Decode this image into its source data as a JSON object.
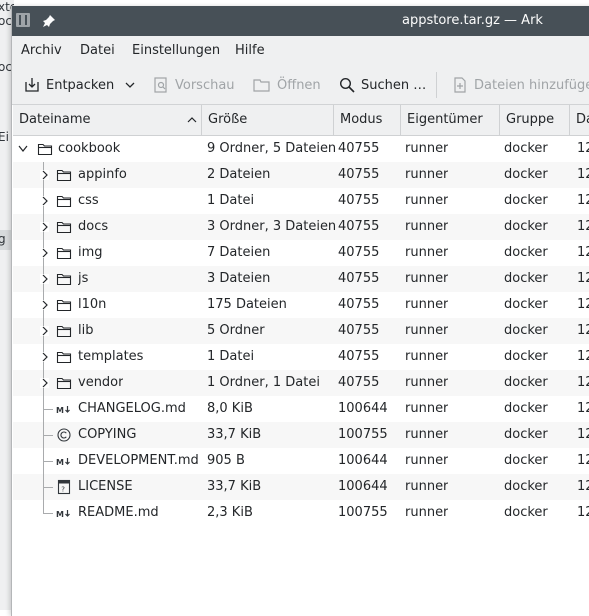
{
  "background": {
    "fragments": [
      "xtcloud/c",
      "oc",
      "Ei",
      "g"
    ]
  },
  "window": {
    "title": "appstore.tar.gz — Ark"
  },
  "menu": [
    "Archiv",
    "Datei",
    "Einstellungen",
    "Hilfe"
  ],
  "toolbar": {
    "extract": "Entpacken",
    "preview": "Vorschau",
    "open": "Öffnen",
    "search": "Suchen …",
    "add_files": "Dateien hinzufügen"
  },
  "columns": [
    "Dateiname",
    "Größe",
    "Modus",
    "Eigentümer",
    "Gruppe",
    "Da"
  ],
  "root": {
    "name": "cookbook",
    "size": "9 Ordner, 5 Dateien",
    "mode": "40755",
    "owner": "runner",
    "group": "docker",
    "date": "12"
  },
  "items": [
    {
      "name": "appinfo",
      "size": "2 Dateien",
      "mode": "40755",
      "owner": "runner",
      "group": "docker",
      "date": "12",
      "type": "folder",
      "icon": "folder-icon"
    },
    {
      "name": "css",
      "size": "1 Datei",
      "mode": "40755",
      "owner": "runner",
      "group": "docker",
      "date": "12",
      "type": "folder",
      "icon": "folder-icon"
    },
    {
      "name": "docs",
      "size": "3 Ordner, 3 Dateien",
      "mode": "40755",
      "owner": "runner",
      "group": "docker",
      "date": "12",
      "type": "folder",
      "icon": "folder-icon"
    },
    {
      "name": "img",
      "size": "7 Dateien",
      "mode": "40755",
      "owner": "runner",
      "group": "docker",
      "date": "12",
      "type": "folder",
      "icon": "folder-icon"
    },
    {
      "name": "js",
      "size": "3 Dateien",
      "mode": "40755",
      "owner": "runner",
      "group": "docker",
      "date": "12",
      "type": "folder",
      "icon": "folder-icon"
    },
    {
      "name": "l10n",
      "size": "175 Dateien",
      "mode": "40755",
      "owner": "runner",
      "group": "docker",
      "date": "12",
      "type": "folder",
      "icon": "folder-icon"
    },
    {
      "name": "lib",
      "size": "5 Ordner",
      "mode": "40755",
      "owner": "runner",
      "group": "docker",
      "date": "12",
      "type": "folder",
      "icon": "folder-icon"
    },
    {
      "name": "templates",
      "size": "1 Datei",
      "mode": "40755",
      "owner": "runner",
      "group": "docker",
      "date": "12",
      "type": "folder",
      "icon": "folder-icon"
    },
    {
      "name": "vendor",
      "size": "1 Ordner, 1 Datei",
      "mode": "40755",
      "owner": "runner",
      "group": "docker",
      "date": "12",
      "type": "folder",
      "icon": "folder-icon"
    },
    {
      "name": "CHANGELOG.md",
      "size": "8,0 KiB",
      "mode": "100644",
      "owner": "runner",
      "group": "docker",
      "date": "12",
      "type": "file",
      "icon": "markdown-icon"
    },
    {
      "name": "COPYING",
      "size": "33,7 KiB",
      "mode": "100755",
      "owner": "runner",
      "group": "docker",
      "date": "12",
      "type": "file",
      "icon": "copyright-icon"
    },
    {
      "name": "DEVELOPMENT.md",
      "size": "905 B",
      "mode": "100644",
      "owner": "runner",
      "group": "docker",
      "date": "12",
      "type": "file",
      "icon": "markdown-icon"
    },
    {
      "name": "LICENSE",
      "size": "33,7 KiB",
      "mode": "100644",
      "owner": "runner",
      "group": "docker",
      "date": "12",
      "type": "file",
      "icon": "unknown-file-icon"
    },
    {
      "name": "README.md",
      "size": "2,3 KiB",
      "mode": "100755",
      "owner": "runner",
      "group": "docker",
      "date": "12",
      "type": "file",
      "icon": "markdown-icon"
    }
  ],
  "colors": {
    "titlebar": "#475057",
    "chrome": "#eff0f1",
    "alt_row": "#f7f7f7",
    "text": "#232629"
  }
}
